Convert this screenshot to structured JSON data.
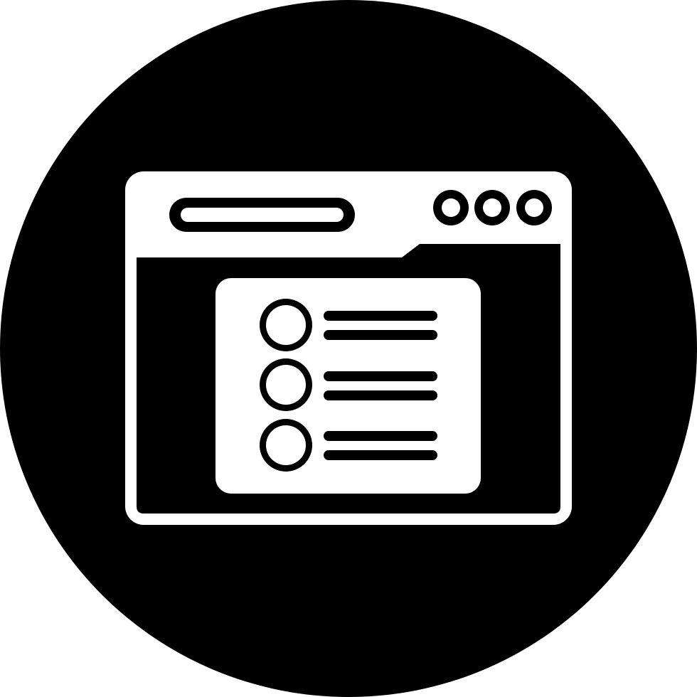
{
  "icon": {
    "name": "browser-window-list-icon",
    "colors": {
      "background": "#000000",
      "foreground": "#ffffff"
    },
    "window_control_dots": 3,
    "list_items": 3,
    "lines_per_item": 2
  }
}
